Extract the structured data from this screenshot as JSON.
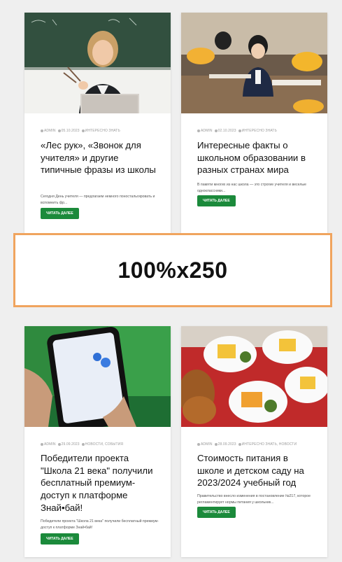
{
  "cards": [
    {
      "meta": {
        "author": "ADMIN",
        "date": "05.10.2023",
        "category": "ИНТЕРЕСНО ЗНАТЬ"
      },
      "title": "«Лес рук», «Звонок для учителя» и другие типичные фразы из школы",
      "excerpt": "Сегодня День учителя — предлагаем немного поностальгировать и вспомнить фр...",
      "button": "ЧИТАТЬ ДАЛЕЕ"
    },
    {
      "meta": {
        "author": "ADMIN",
        "date": "02.10.2023",
        "category": "ИНТЕРЕСНО ЗНАТЬ"
      },
      "title": "Интересные факты о школьном образовании в разных странах мира",
      "excerpt": "В памяти многих из нас школа — это строгие учителя и веселые одноклассники...",
      "button": "ЧИТАТЬ ДАЛЕЕ"
    },
    {
      "meta": {
        "author": "ADMIN",
        "date": "29.09.2023",
        "category": "НОВОСТИ, СОБЫТИЯ"
      },
      "title": "Победители проекта \"Школа 21 века\" получили бесплатный премиум-доступ к платформе Знай•бай!",
      "excerpt": "Победители проекта \"Школа 21 века\" получили бесплатный премиум-доступ к платформе Знай•бай!",
      "button": "ЧИТАТЬ ДАЛЕЕ"
    },
    {
      "meta": {
        "author": "ADMIN",
        "date": "28.09.2023",
        "category": "ИНТЕРЕСНО ЗНАТЬ, НОВОСТИ"
      },
      "title": "Стоимость питания в школе и детском саду на 2023/2024 учебный год",
      "excerpt": "Правительство внесло изменения в постановление №217, которое регламентирует нормы питания у школьник...",
      "button": "ЧИТАТЬ ДАЛЕЕ"
    }
  ],
  "ad": {
    "label": "100%x250"
  },
  "colors": {
    "button": "#1b8a3b",
    "ad_border": "#f0a45e",
    "page_bg": "#efefef"
  },
  "images": [
    "teacher-photo",
    "schoolchildren-photo",
    "phone-app-photo",
    "school-lunch-photo"
  ]
}
